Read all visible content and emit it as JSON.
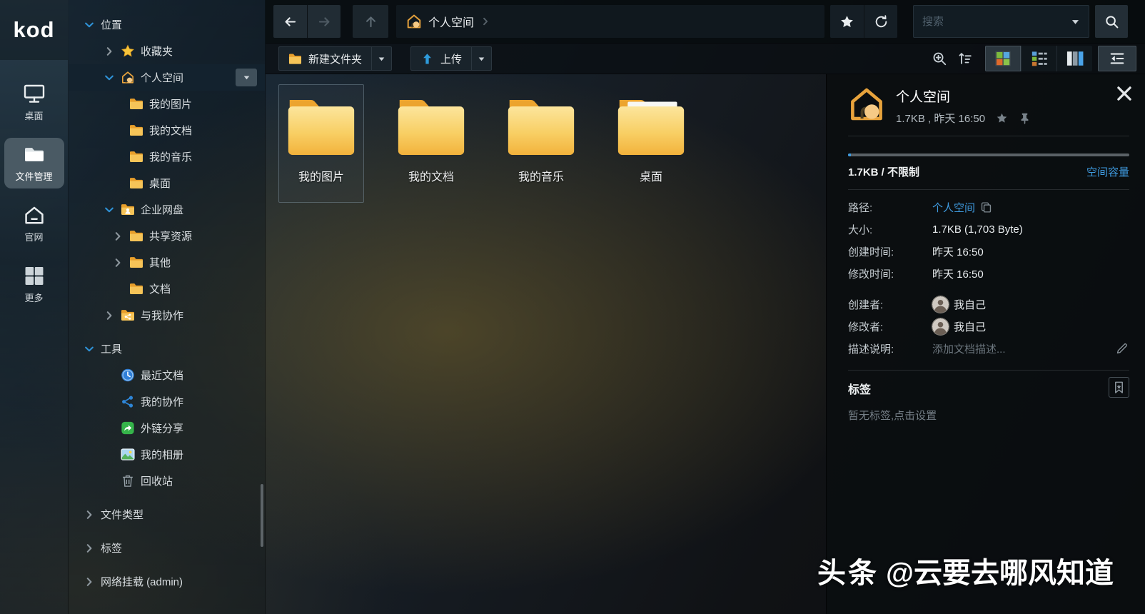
{
  "appbar": {
    "logo": "kod",
    "items": [
      {
        "label": "桌面",
        "icon": "monitor-icon",
        "active": false
      },
      {
        "label": "文件管理",
        "icon": "folder-white-icon",
        "active": true
      },
      {
        "label": "官网",
        "icon": "home-outline-icon",
        "active": false
      },
      {
        "label": "更多",
        "icon": "grid-icon",
        "active": false
      }
    ]
  },
  "sidebar": {
    "tree": [
      {
        "label": "位置",
        "depth": 0,
        "expand": "open"
      },
      {
        "label": "收藏夹",
        "depth": 1,
        "expand": "closed",
        "icon": "star-icon"
      },
      {
        "label": "个人空间",
        "depth": 1,
        "expand": "open",
        "icon": "home-icon",
        "selected": true,
        "has_menu": true
      },
      {
        "label": "我的图片",
        "depth": 2,
        "icon": "folder-icon"
      },
      {
        "label": "我的文档",
        "depth": 2,
        "icon": "folder-icon"
      },
      {
        "label": "我的音乐",
        "depth": 2,
        "icon": "folder-icon"
      },
      {
        "label": "桌面",
        "depth": 2,
        "icon": "folder-icon"
      },
      {
        "label": "企业网盘",
        "depth": 1,
        "expand": "open",
        "icon": "folder-user-icon"
      },
      {
        "label": "共享资源",
        "depth": 2,
        "expand": "closed",
        "icon": "folder-icon"
      },
      {
        "label": "其他",
        "depth": 2,
        "expand": "closed",
        "icon": "folder-icon"
      },
      {
        "label": "文档",
        "depth": 2,
        "icon": "folder-icon"
      },
      {
        "label": "与我协作",
        "depth": 1,
        "expand": "closed",
        "icon": "folder-share-icon"
      },
      {
        "label": "工具",
        "depth": 0,
        "expand": "open",
        "section_gap": true
      },
      {
        "label": "最近文档",
        "depth": 1,
        "icon": "clock-icon"
      },
      {
        "label": "我的协作",
        "depth": 1,
        "icon": "share-icon"
      },
      {
        "label": "外链分享",
        "depth": 1,
        "icon": "external-link-icon"
      },
      {
        "label": "我的相册",
        "depth": 1,
        "icon": "photo-icon"
      },
      {
        "label": "回收站",
        "depth": 1,
        "icon": "trash-icon"
      },
      {
        "label": "文件类型",
        "depth": 0,
        "expand": "closed",
        "section_gap": true
      },
      {
        "label": "标签",
        "depth": 0,
        "expand": "closed",
        "section_gap": true
      },
      {
        "label": "网络挂载 (admin)",
        "depth": 0,
        "expand": "closed",
        "section_gap": true
      }
    ]
  },
  "toolbar": {
    "breadcrumb": {
      "location": "个人空间"
    },
    "search": {
      "placeholder": "搜索"
    }
  },
  "actionbar": {
    "new_folder_label": "新建文件夹",
    "upload_label": "上传"
  },
  "files": {
    "items": [
      {
        "name": "我的图片",
        "selected": true,
        "variant": "plain"
      },
      {
        "name": "我的文档",
        "selected": false,
        "variant": "plain"
      },
      {
        "name": "我的音乐",
        "selected": false,
        "variant": "plain"
      },
      {
        "name": "桌面",
        "selected": false,
        "variant": "paper"
      }
    ]
  },
  "panel": {
    "header": {
      "title": "个人空间",
      "meta": "1.7KB , 昨天 16:50"
    },
    "quota": {
      "used": "1.7KB / 不限制",
      "link": "空间容量"
    },
    "rows": [
      {
        "label": "路径:",
        "type": "link",
        "value": "个人空间",
        "trail_icon": "copy-icon"
      },
      {
        "label": "大小:",
        "type": "text",
        "value": "1.7KB (1,703 Byte)"
      },
      {
        "label": "创建时间:",
        "type": "text",
        "value": "昨天 16:50"
      },
      {
        "label": "修改时间:",
        "type": "text",
        "value": "昨天 16:50"
      },
      {
        "label": "创建者:",
        "type": "user",
        "value": "我自己",
        "gap": true
      },
      {
        "label": "修改者:",
        "type": "user",
        "value": "我自己"
      },
      {
        "label": "描述说明:",
        "type": "placeholder",
        "value": "添加文档描述...",
        "trail_icon": "pencil-icon"
      }
    ],
    "tags": {
      "title": "标签",
      "empty": "暂无标签,点击设置"
    }
  },
  "watermark": {
    "brand": "头条",
    "handle": "@云要去哪风知道"
  },
  "colors": {
    "accent_blue": "#2f8fd8",
    "link_blue": "#3f9be0",
    "folder_yellow": "#f5c04b",
    "selected_row": "#13222e",
    "active_tile": "#4a5a64"
  }
}
